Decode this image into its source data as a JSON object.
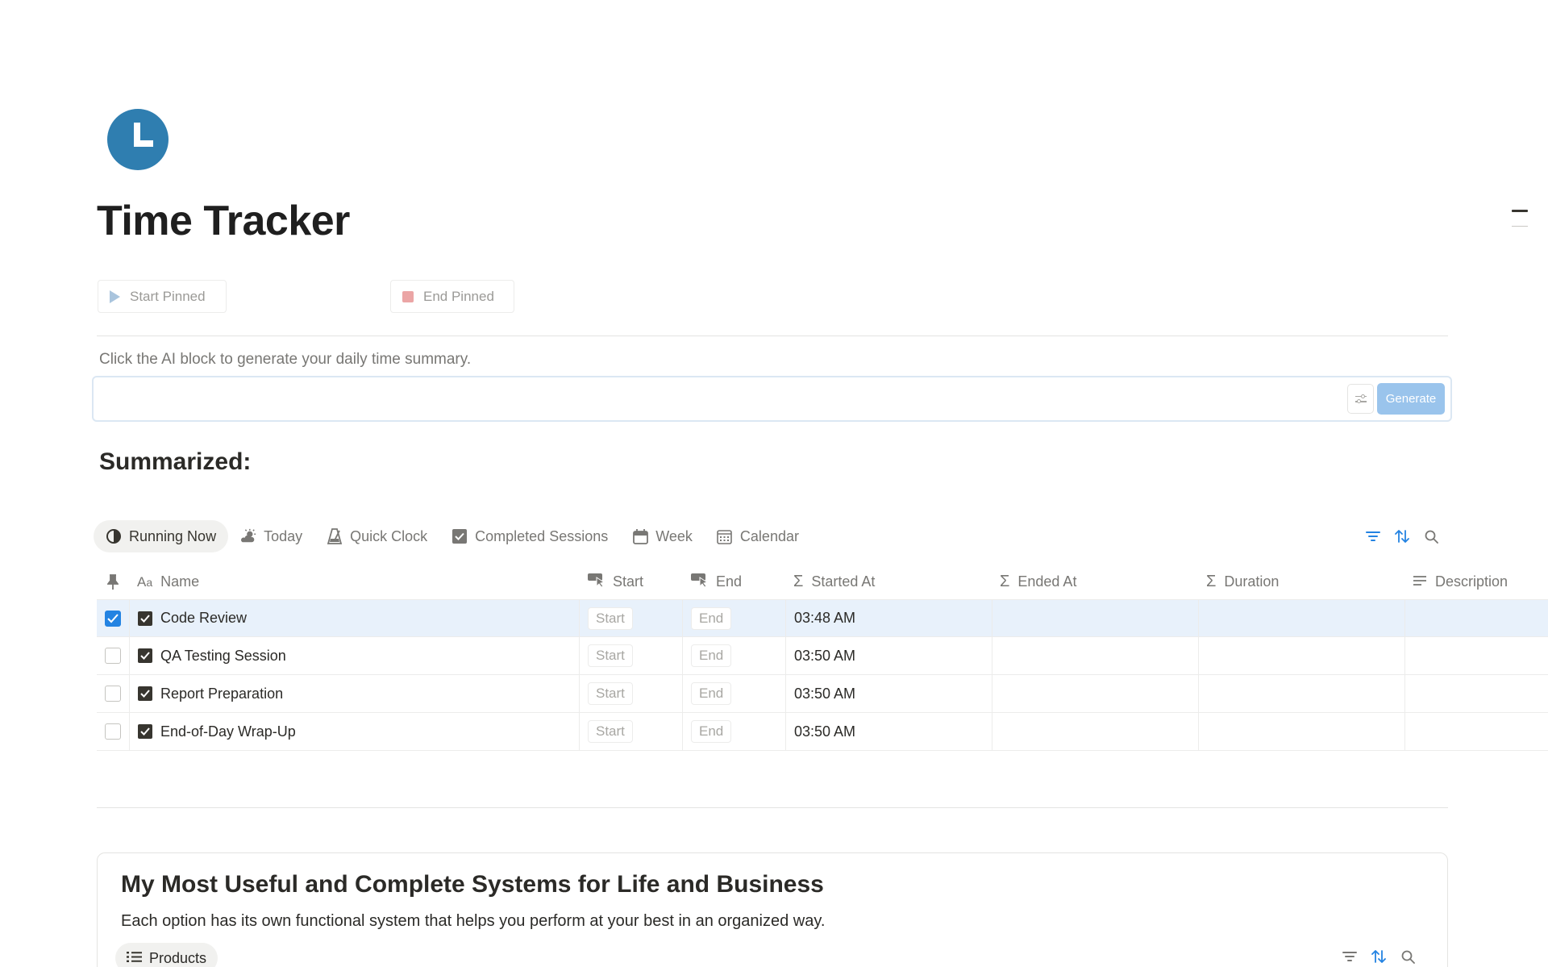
{
  "page": {
    "title": "Time Tracker",
    "icon": "clock-icon",
    "accent": "#2f7eb0"
  },
  "pinned": {
    "start_label": "Start Pinned",
    "end_label": "End Pinned"
  },
  "ai": {
    "hint": "Click the AI block to generate your daily time summary.",
    "generate_label": "Generate"
  },
  "summary_heading": "Summarized:",
  "views": {
    "tabs": [
      {
        "label": "Running Now",
        "icon": "half-circle-icon"
      },
      {
        "label": "Today",
        "icon": "weather-icon"
      },
      {
        "label": "Quick Clock",
        "icon": "metronome-icon"
      },
      {
        "label": "Completed Sessions",
        "icon": "checkbox-icon"
      },
      {
        "label": "Week",
        "icon": "calendar-icon"
      },
      {
        "label": "Calendar",
        "icon": "calendar-grid-icon"
      }
    ],
    "active": "Running Now"
  },
  "table": {
    "columns": {
      "name": "Name",
      "start": "Start",
      "end": "End",
      "started_at": "Started At",
      "ended_at": "Ended At",
      "duration": "Duration",
      "description": "Description"
    },
    "rows": [
      {
        "name": "Code Review",
        "start": "Start",
        "end": "End",
        "started_at": "03:48 AM",
        "selected": true
      },
      {
        "name": "QA Testing Session",
        "start": "Start",
        "end": "End",
        "started_at": "03:50 AM",
        "selected": false
      },
      {
        "name": "Report Preparation",
        "start": "Start",
        "end": "End",
        "started_at": "03:50 AM",
        "selected": false
      },
      {
        "name": "End-of-Day Wrap-Up",
        "start": "Start",
        "end": "End",
        "started_at": "03:50 AM",
        "selected": false
      }
    ]
  },
  "products": {
    "title": "My Most Useful and Complete Systems for Life and Business",
    "subtitle": "Each option has its own functional system that helps you perform at your best in an organized way.",
    "tab_label": "Products"
  }
}
